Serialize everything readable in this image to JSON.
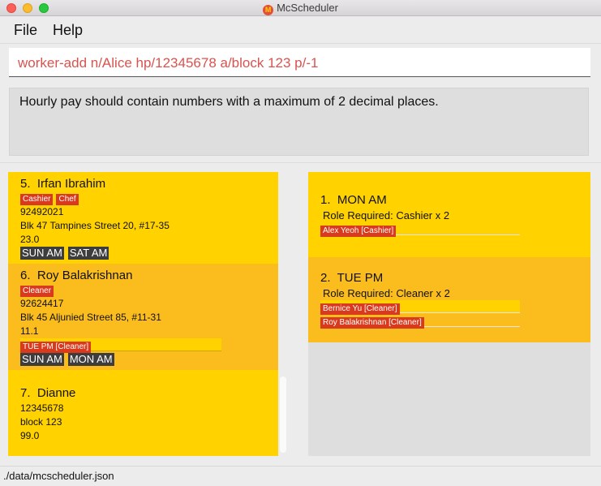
{
  "window": {
    "title": "McScheduler",
    "app_icon": "M"
  },
  "menu": {
    "file": "File",
    "help": "Help"
  },
  "command": {
    "value": "worker-add n/Alice hp/12345678 a/block 123 p/-1"
  },
  "result": {
    "message": "Hourly pay should contain numbers with a maximum of 2 decimal places."
  },
  "workers": [
    {
      "index": "5.",
      "name": "Irfan Ibrahim",
      "roles": [
        "Cashier",
        "Chef"
      ],
      "phone": "92492021",
      "address": "Blk 47 Tampines Street 20, #17-35",
      "pay": "23.0",
      "assignments": [],
      "availability": [
        "SUN AM",
        "SAT AM"
      ]
    },
    {
      "index": "6.",
      "name": "Roy Balakrishnan",
      "roles": [
        "Cleaner"
      ],
      "phone": "92624417",
      "address": "Blk 45 Aljunied Street 85, #11-31",
      "pay": "11.1",
      "assignments": [
        "TUE PM [Cleaner]"
      ],
      "availability": [
        "SUN AM",
        "MON AM"
      ]
    },
    {
      "index": "7.",
      "name": "Dianne",
      "roles": [],
      "phone": "12345678",
      "address": "block 123",
      "pay": "99.0",
      "assignments": [],
      "availability": []
    }
  ],
  "shifts": [
    {
      "index": "1.",
      "name": "MON AM",
      "role_required": "Role Required: Cashier x 2",
      "assigned": [
        "Alex Yeoh [Cashier]"
      ]
    },
    {
      "index": "2.",
      "name": "TUE PM",
      "role_required": "Role Required: Cleaner x 2",
      "assigned": [
        "Bernice Yu [Cleaner]",
        "Roy Balakrishnan [Cleaner]"
      ]
    }
  ],
  "status": {
    "path": "./data/mcscheduler.json"
  },
  "colors": {
    "card_odd": "#ffd200",
    "card_even": "#fbbd1e",
    "tag": "#d9391c",
    "error_text": "#d9534f"
  }
}
